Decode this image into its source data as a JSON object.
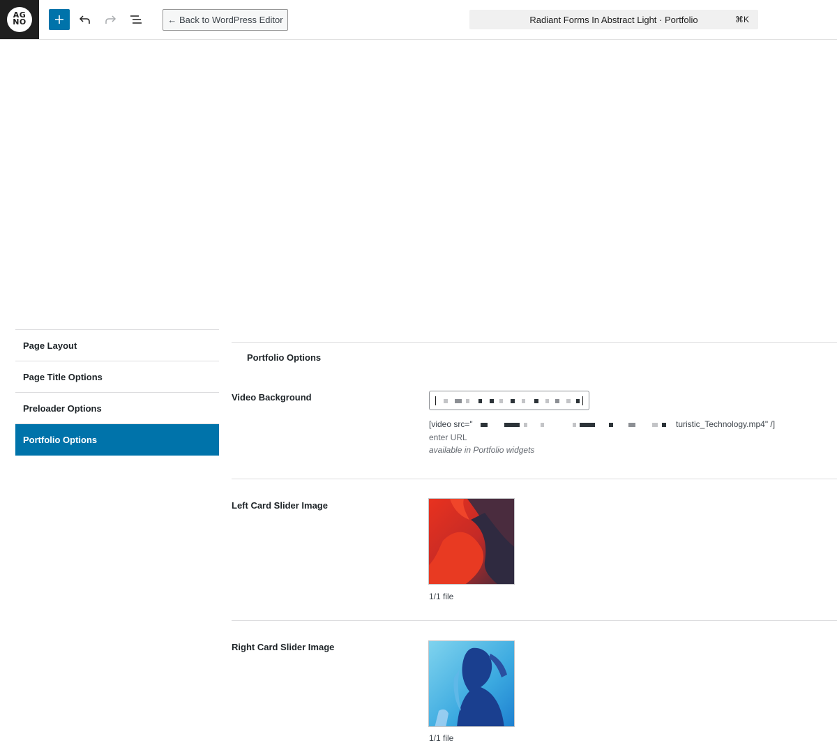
{
  "logo": {
    "line1": "AG",
    "line2": "NO"
  },
  "toolbar": {
    "add_icon": "plus-icon",
    "undo_icon": "undo-icon",
    "redo_icon": "redo-icon",
    "list_view_icon": "list-view-icon",
    "back_label": "← Back to WordPress Editor",
    "command_title": "Radiant Forms In Abstract Light · Portfolio",
    "command_shortcut": "⌘K"
  },
  "sidebar": {
    "items": [
      {
        "label": "Page Layout",
        "active": false
      },
      {
        "label": "Page Title Options",
        "active": false
      },
      {
        "label": "Preloader Options",
        "active": false
      },
      {
        "label": "Portfolio Options",
        "active": true
      }
    ]
  },
  "panel": {
    "title": "Portfolio Options",
    "video": {
      "label": "Video Background",
      "shortcode_prefix": "[video src=\"",
      "shortcode_suffix": "turistic_Technology.mp4\" /]",
      "help": "enter URL",
      "description": "available in Portfolio widgets"
    },
    "left_slider": {
      "label": "Left Card Slider Image",
      "file_count": "1/1 file"
    },
    "right_slider": {
      "label": "Right Card Slider Image",
      "file_count": "1/1 file"
    }
  },
  "colors": {
    "accent": "#0073aa",
    "logo_bg": "#1e1e1e"
  }
}
